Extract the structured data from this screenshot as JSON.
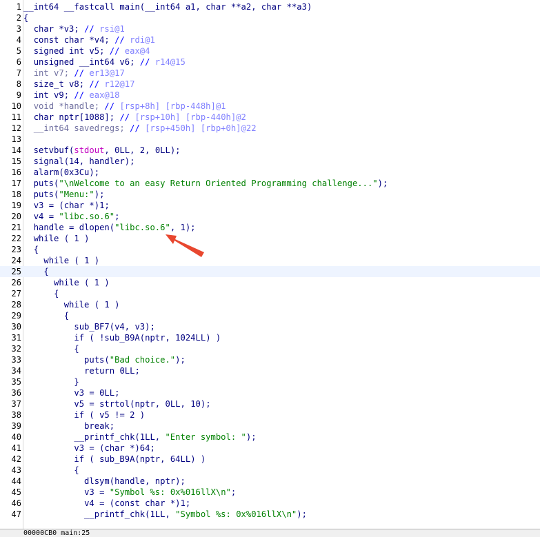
{
  "code_lines": [
    {
      "n": "1",
      "segs": [
        [
          "t",
          "__int64"
        ],
        [
          "p",
          " "
        ],
        [
          "t",
          "__fastcall"
        ],
        [
          "p",
          " main("
        ],
        [
          "t",
          "__int64"
        ],
        [
          "p",
          " a1, "
        ],
        [
          "t",
          "char"
        ],
        [
          "p",
          " **a2, "
        ],
        [
          "t",
          "char"
        ],
        [
          "p",
          " **a3)"
        ]
      ]
    },
    {
      "n": "2",
      "segs": [
        [
          "p",
          "{"
        ]
      ]
    },
    {
      "n": "3",
      "segs": [
        [
          "p",
          "  "
        ],
        [
          "t",
          "char"
        ],
        [
          "p",
          " *v3; "
        ],
        [
          "c",
          "// "
        ],
        [
          "r",
          "rsi@1"
        ]
      ]
    },
    {
      "n": "4",
      "segs": [
        [
          "p",
          "  "
        ],
        [
          "t",
          "const char"
        ],
        [
          "p",
          " *v4; "
        ],
        [
          "c",
          "// "
        ],
        [
          "r",
          "rdi@1"
        ]
      ]
    },
    {
      "n": "5",
      "segs": [
        [
          "p",
          "  "
        ],
        [
          "t",
          "signed int"
        ],
        [
          "p",
          " v5; "
        ],
        [
          "c",
          "// "
        ],
        [
          "r",
          "eax@4"
        ]
      ]
    },
    {
      "n": "6",
      "segs": [
        [
          "p",
          "  "
        ],
        [
          "t",
          "unsigned __int64"
        ],
        [
          "p",
          " v6; "
        ],
        [
          "c",
          "// "
        ],
        [
          "r",
          "r14@15"
        ]
      ]
    },
    {
      "n": "7",
      "segs": [
        [
          "p",
          "  "
        ],
        [
          "dv",
          "int v7;"
        ],
        [
          "p",
          " "
        ],
        [
          "c",
          "// "
        ],
        [
          "r",
          "er13@17"
        ]
      ]
    },
    {
      "n": "8",
      "segs": [
        [
          "p",
          "  "
        ],
        [
          "t",
          "size_t"
        ],
        [
          "p",
          " v8; "
        ],
        [
          "c",
          "// "
        ],
        [
          "r",
          "r12@17"
        ]
      ]
    },
    {
      "n": "9",
      "segs": [
        [
          "p",
          "  "
        ],
        [
          "t",
          "int"
        ],
        [
          "p",
          " v9; "
        ],
        [
          "c",
          "// "
        ],
        [
          "r",
          "eax@18"
        ]
      ]
    },
    {
      "n": "10",
      "segs": [
        [
          "p",
          "  "
        ],
        [
          "dv",
          "void *handle;"
        ],
        [
          "p",
          " "
        ],
        [
          "c",
          "// "
        ],
        [
          "r",
          "[rsp+8h] [rbp-448h]@1"
        ]
      ]
    },
    {
      "n": "11",
      "segs": [
        [
          "p",
          "  "
        ],
        [
          "t",
          "char"
        ],
        [
          "p",
          " nptr[1088]; "
        ],
        [
          "c",
          "// "
        ],
        [
          "r",
          "[rsp+10h] [rbp-440h]@2"
        ]
      ]
    },
    {
      "n": "12",
      "segs": [
        [
          "p",
          "  "
        ],
        [
          "dv",
          "__int64 savedregs;"
        ],
        [
          "p",
          " "
        ],
        [
          "c",
          "// "
        ],
        [
          "r",
          "[rsp+450h] [rbp+0h]@22"
        ]
      ]
    },
    {
      "n": "13",
      "segs": []
    },
    {
      "n": "14",
      "segs": [
        [
          "p",
          "  setvbuf("
        ],
        [
          "gv",
          "stdout"
        ],
        [
          "p",
          ", "
        ],
        [
          "p",
          "0LL"
        ],
        [
          "p",
          ", "
        ],
        [
          "p",
          "2"
        ],
        [
          "p",
          ", "
        ],
        [
          "p",
          "0LL"
        ],
        [
          "p",
          ");"
        ]
      ]
    },
    {
      "n": "15",
      "segs": [
        [
          "p",
          "  signal("
        ],
        [
          "p",
          "14"
        ],
        [
          "p",
          ", handler);"
        ]
      ]
    },
    {
      "n": "16",
      "segs": [
        [
          "p",
          "  alarm("
        ],
        [
          "p",
          "0x3Cu"
        ],
        [
          "p",
          ");"
        ]
      ]
    },
    {
      "n": "17",
      "segs": [
        [
          "p",
          "  puts("
        ],
        [
          "s",
          "\"\\nWelcome to an easy Return Oriented Programming challenge...\""
        ],
        [
          "p",
          ");"
        ]
      ]
    },
    {
      "n": "18",
      "segs": [
        [
          "p",
          "  puts("
        ],
        [
          "s",
          "\"Menu:\""
        ],
        [
          "p",
          ");"
        ]
      ]
    },
    {
      "n": "19",
      "segs": [
        [
          "p",
          "  "
        ],
        [
          "v",
          "v3"
        ],
        [
          "p",
          " = ("
        ],
        [
          "t",
          "char"
        ],
        [
          "p",
          " *)"
        ],
        [
          "p",
          "1"
        ],
        [
          "p",
          ";"
        ]
      ]
    },
    {
      "n": "20",
      "segs": [
        [
          "p",
          "  "
        ],
        [
          "v",
          "v4"
        ],
        [
          "p",
          " = "
        ],
        [
          "s",
          "\"libc.so.6\""
        ],
        [
          "p",
          ";"
        ]
      ]
    },
    {
      "n": "21",
      "segs": [
        [
          "p",
          "  "
        ],
        [
          "v",
          "handle"
        ],
        [
          "p",
          " = dlopen("
        ],
        [
          "s",
          "\"libc.so.6\""
        ],
        [
          "p",
          ", "
        ],
        [
          "p",
          "1"
        ],
        [
          "p",
          ");"
        ]
      ]
    },
    {
      "n": "22",
      "segs": [
        [
          "p",
          "  "
        ],
        [
          "k",
          "while"
        ],
        [
          "p",
          " ( "
        ],
        [
          "p",
          "1"
        ],
        [
          "p",
          " )"
        ]
      ]
    },
    {
      "n": "23",
      "segs": [
        [
          "p",
          "  {"
        ]
      ]
    },
    {
      "n": "24",
      "segs": [
        [
          "p",
          "    "
        ],
        [
          "k",
          "while"
        ],
        [
          "p",
          " ( "
        ],
        [
          "p",
          "1"
        ],
        [
          "p",
          " )"
        ]
      ]
    },
    {
      "n": "25",
      "segs": [
        [
          "p",
          "    {"
        ]
      ],
      "current": true
    },
    {
      "n": "26",
      "segs": [
        [
          "p",
          "      "
        ],
        [
          "k",
          "while"
        ],
        [
          "p",
          " ( "
        ],
        [
          "p",
          "1"
        ],
        [
          "p",
          " )"
        ]
      ]
    },
    {
      "n": "27",
      "segs": [
        [
          "p",
          "      {"
        ]
      ]
    },
    {
      "n": "28",
      "segs": [
        [
          "p",
          "        "
        ],
        [
          "k",
          "while"
        ],
        [
          "p",
          " ( "
        ],
        [
          "p",
          "1"
        ],
        [
          "p",
          " )"
        ]
      ]
    },
    {
      "n": "29",
      "segs": [
        [
          "p",
          "        {"
        ]
      ]
    },
    {
      "n": "30",
      "segs": [
        [
          "p",
          "          sub_BF7("
        ],
        [
          "v",
          "v4"
        ],
        [
          "p",
          ", "
        ],
        [
          "v",
          "v3"
        ],
        [
          "p",
          ");"
        ]
      ]
    },
    {
      "n": "31",
      "segs": [
        [
          "p",
          "          "
        ],
        [
          "k",
          "if"
        ],
        [
          "p",
          " ( !sub_B9A("
        ],
        [
          "v",
          "nptr"
        ],
        [
          "p",
          ", "
        ],
        [
          "p",
          "1024LL"
        ],
        [
          "p",
          ") )"
        ]
      ]
    },
    {
      "n": "32",
      "segs": [
        [
          "p",
          "          {"
        ]
      ]
    },
    {
      "n": "33",
      "segs": [
        [
          "p",
          "            puts("
        ],
        [
          "s",
          "\"Bad choice.\""
        ],
        [
          "p",
          ");"
        ]
      ]
    },
    {
      "n": "34",
      "segs": [
        [
          "p",
          "            "
        ],
        [
          "k",
          "return"
        ],
        [
          "p",
          " "
        ],
        [
          "p",
          "0LL"
        ],
        [
          "p",
          ";"
        ]
      ]
    },
    {
      "n": "35",
      "segs": [
        [
          "p",
          "          }"
        ]
      ]
    },
    {
      "n": "36",
      "segs": [
        [
          "p",
          "          "
        ],
        [
          "v",
          "v3"
        ],
        [
          "p",
          " = "
        ],
        [
          "p",
          "0LL"
        ],
        [
          "p",
          ";"
        ]
      ]
    },
    {
      "n": "37",
      "segs": [
        [
          "p",
          "          "
        ],
        [
          "v",
          "v5"
        ],
        [
          "p",
          " = strtol("
        ],
        [
          "v",
          "nptr"
        ],
        [
          "p",
          ", "
        ],
        [
          "p",
          "0LL"
        ],
        [
          "p",
          ", "
        ],
        [
          "p",
          "10"
        ],
        [
          "p",
          ");"
        ]
      ]
    },
    {
      "n": "38",
      "segs": [
        [
          "p",
          "          "
        ],
        [
          "k",
          "if"
        ],
        [
          "p",
          " ( "
        ],
        [
          "v",
          "v5"
        ],
        [
          "p",
          " != "
        ],
        [
          "p",
          "2"
        ],
        [
          "p",
          " )"
        ]
      ]
    },
    {
      "n": "39",
      "segs": [
        [
          "p",
          "            "
        ],
        [
          "k",
          "break"
        ],
        [
          "p",
          ";"
        ]
      ]
    },
    {
      "n": "40",
      "segs": [
        [
          "p",
          "          __printf_chk("
        ],
        [
          "p",
          "1LL"
        ],
        [
          "p",
          ", "
        ],
        [
          "s",
          "\"Enter symbol: \""
        ],
        [
          "p",
          ");"
        ]
      ]
    },
    {
      "n": "41",
      "segs": [
        [
          "p",
          "          "
        ],
        [
          "v",
          "v3"
        ],
        [
          "p",
          " = ("
        ],
        [
          "t",
          "char"
        ],
        [
          "p",
          " *)"
        ],
        [
          "p",
          "64"
        ],
        [
          "p",
          ";"
        ]
      ]
    },
    {
      "n": "42",
      "segs": [
        [
          "p",
          "          "
        ],
        [
          "k",
          "if"
        ],
        [
          "p",
          " ( sub_B9A("
        ],
        [
          "v",
          "nptr"
        ],
        [
          "p",
          ", "
        ],
        [
          "p",
          "64LL"
        ],
        [
          "p",
          ") )"
        ]
      ]
    },
    {
      "n": "43",
      "segs": [
        [
          "p",
          "          {"
        ]
      ]
    },
    {
      "n": "44",
      "segs": [
        [
          "p",
          "            dlsym("
        ],
        [
          "v",
          "handle"
        ],
        [
          "p",
          ", "
        ],
        [
          "v",
          "nptr"
        ],
        [
          "p",
          ");"
        ]
      ]
    },
    {
      "n": "45",
      "segs": [
        [
          "p",
          "            "
        ],
        [
          "v",
          "v3"
        ],
        [
          "p",
          " = "
        ],
        [
          "s",
          "\"Symbol %s: 0x%016llX\\n\""
        ],
        [
          "p",
          ";"
        ]
      ]
    },
    {
      "n": "46",
      "segs": [
        [
          "p",
          "            "
        ],
        [
          "v",
          "v4"
        ],
        [
          "p",
          " = ("
        ],
        [
          "t",
          "const char"
        ],
        [
          "p",
          " *)"
        ],
        [
          "p",
          "1"
        ],
        [
          "p",
          ";"
        ]
      ]
    },
    {
      "n": "47",
      "segs": [
        [
          "p",
          "            __printf_chk("
        ],
        [
          "p",
          "1LL"
        ],
        [
          "p",
          ", "
        ],
        [
          "s",
          "\"Symbol %s: 0x%016llX\\n\""
        ],
        [
          "p",
          ");"
        ]
      ]
    }
  ],
  "status_bar": {
    "location": "00000CB0 main:25"
  },
  "colors": {
    "background": "#ffffff",
    "keyword": "#000080",
    "string": "#008000",
    "comment": "#0000ff",
    "register_comment": "#8080ff",
    "global": "#c000c0",
    "annotation_arrow": "#e8472f"
  },
  "annotation": {
    "type": "arrow",
    "target": "libc.so.6 in dlopen call",
    "icon": "red-arrow-icon"
  }
}
